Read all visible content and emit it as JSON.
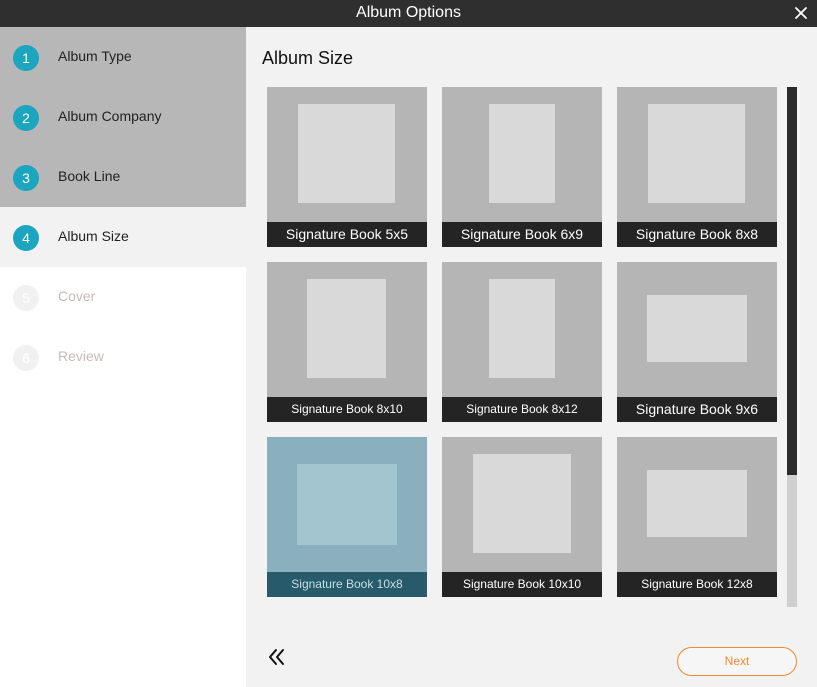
{
  "window": {
    "title": "Album Options",
    "close_icon": "close-icon"
  },
  "steps": [
    {
      "number": "1",
      "label": "Album Type",
      "state": "done"
    },
    {
      "number": "2",
      "label": "Album Company",
      "state": "done"
    },
    {
      "number": "3",
      "label": "Book Line",
      "state": "done"
    },
    {
      "number": "4",
      "label": "Album Size",
      "state": "active"
    },
    {
      "number": "5",
      "label": "Cover",
      "state": "disabled"
    },
    {
      "number": "6",
      "label": "Review",
      "state": "disabled"
    }
  ],
  "main": {
    "heading": "Album Size",
    "sizes": [
      {
        "label": "Signature Book 5x5",
        "selected": false
      },
      {
        "label": "Signature Book 6x9",
        "selected": false
      },
      {
        "label": "Signature Book 8x8",
        "selected": false
      },
      {
        "label": "Signature Book 8x10",
        "selected": false
      },
      {
        "label": "Signature Book 8x12",
        "selected": false
      },
      {
        "label": "Signature Book 9x6",
        "selected": false
      },
      {
        "label": "Signature Book 10x8",
        "selected": true
      },
      {
        "label": "Signature Book 10x10",
        "selected": false
      },
      {
        "label": "Signature Book 12x8",
        "selected": false
      }
    ]
  },
  "footer": {
    "back_icon": "double-chevron-left-icon",
    "next_label": "Next"
  },
  "colors": {
    "accent_teal": "#1ba5bf",
    "next_orange": "#f08a2d",
    "title_bar": "#2f2f2f"
  }
}
